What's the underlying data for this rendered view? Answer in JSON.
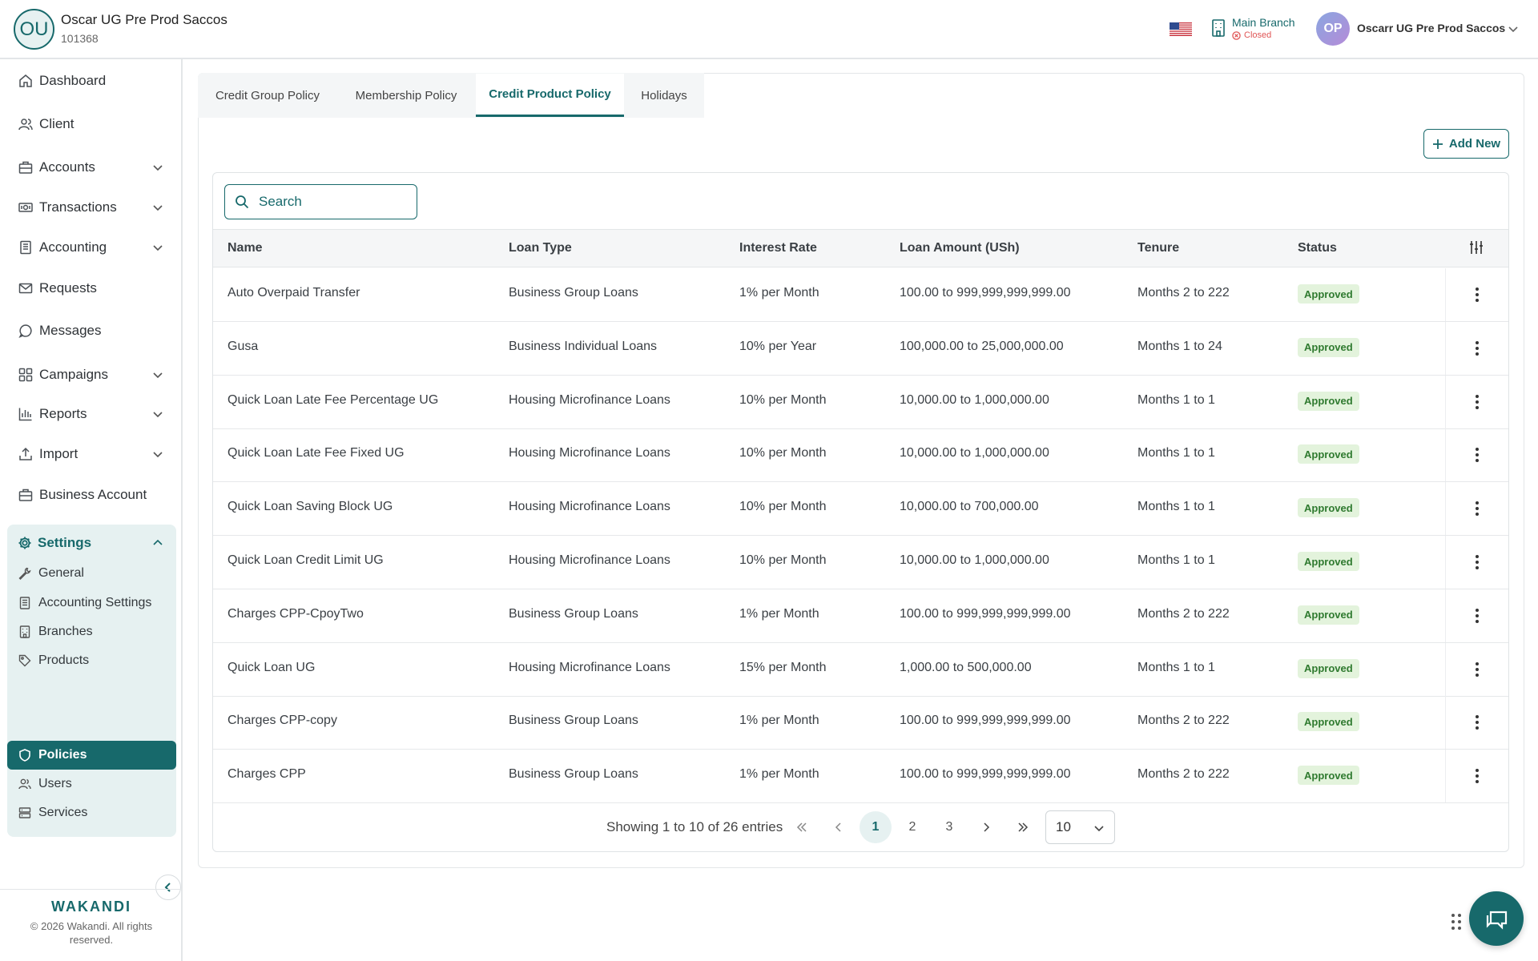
{
  "header": {
    "org_initials": "OU",
    "org_name": "Oscar UG Pre Prod Saccos",
    "org_id": "101368",
    "branch_name": "Main Branch",
    "branch_status": "Closed",
    "user_initials": "OP",
    "user_name": "Oscarr UG Pre Prod Saccos"
  },
  "sidebar": {
    "items": [
      {
        "label": "Dashboard",
        "icon": "home-icon"
      },
      {
        "label": "Client",
        "icon": "users-icon"
      },
      {
        "label": "Accounts",
        "icon": "briefcase-icon"
      },
      {
        "label": "Transactions",
        "icon": "cash-icon"
      },
      {
        "label": "Accounting",
        "icon": "ledger-icon"
      },
      {
        "label": "Requests",
        "icon": "mail-icon"
      },
      {
        "label": "Messages",
        "icon": "chat-icon"
      },
      {
        "label": "Campaigns",
        "icon": "grid-icon"
      },
      {
        "label": "Reports",
        "icon": "bar-chart-icon"
      },
      {
        "label": "Import",
        "icon": "upload-icon"
      },
      {
        "label": "Business Account",
        "icon": "briefcase-icon"
      }
    ],
    "settings": {
      "label": "Settings",
      "items": [
        {
          "label": "General"
        },
        {
          "label": "Accounting Settings"
        },
        {
          "label": "Branches"
        },
        {
          "label": "Products"
        },
        {
          "label": "Policies"
        },
        {
          "label": "Users"
        },
        {
          "label": "Services"
        }
      ]
    },
    "footer": {
      "logo": "WAKANDI",
      "copyright": "© 2026 Wakandi. All rights reserved."
    }
  },
  "tabs": [
    "Credit Group Policy",
    "Membership Policy",
    "Credit Product Policy",
    "Holidays"
  ],
  "active_tab": "Credit Product Policy",
  "add_button": "Add New",
  "search": {
    "placeholder": "Search"
  },
  "table": {
    "columns": [
      "Name",
      "Loan Type",
      "Interest Rate",
      "Loan Amount (USh)",
      "Tenure",
      "Status"
    ],
    "rows": [
      {
        "name": "Auto Overpaid Transfer",
        "loan_type": "Business Group Loans",
        "interest": "1% per Month",
        "amount": "100.00 to 999,999,999,999.00",
        "tenure": "Months 2 to 222",
        "status": "Approved"
      },
      {
        "name": "Gusa",
        "loan_type": "Business Individual Loans",
        "interest": "10% per Year",
        "amount": "100,000.00 to 25,000,000.00",
        "tenure": "Months 1 to 24",
        "status": "Approved"
      },
      {
        "name": "Quick Loan Late Fee Percentage UG",
        "loan_type": "Housing Microfinance Loans",
        "interest": "10% per Month",
        "amount": "10,000.00 to 1,000,000.00",
        "tenure": "Months 1 to 1",
        "status": "Approved"
      },
      {
        "name": "Quick Loan Late Fee Fixed UG",
        "loan_type": "Housing Microfinance Loans",
        "interest": "10% per Month",
        "amount": "10,000.00 to 1,000,000.00",
        "tenure": "Months 1 to 1",
        "status": "Approved"
      },
      {
        "name": "Quick Loan Saving Block UG",
        "loan_type": "Housing Microfinance Loans",
        "interest": "10% per Month",
        "amount": "10,000.00 to 700,000.00",
        "tenure": "Months 1 to 1",
        "status": "Approved"
      },
      {
        "name": "Quick Loan Credit Limit UG",
        "loan_type": "Housing Microfinance Loans",
        "interest": "10% per Month",
        "amount": "10,000.00 to 1,000,000.00",
        "tenure": "Months 1 to 1",
        "status": "Approved"
      },
      {
        "name": "Charges CPP-CpoyTwo",
        "loan_type": "Business Group Loans",
        "interest": "1% per Month",
        "amount": "100.00 to 999,999,999,999.00",
        "tenure": "Months 2 to 222",
        "status": "Approved"
      },
      {
        "name": "Quick Loan UG",
        "loan_type": "Housing Microfinance Loans",
        "interest": "15% per Month",
        "amount": "1,000.00 to 500,000.00",
        "tenure": "Months 1 to 1",
        "status": "Approved"
      },
      {
        "name": "Charges CPP-copy",
        "loan_type": "Business Group Loans",
        "interest": "1% per Month",
        "amount": "100.00 to 999,999,999,999.00",
        "tenure": "Months 2 to 222",
        "status": "Approved"
      },
      {
        "name": "Charges CPP",
        "loan_type": "Business Group Loans",
        "interest": "1% per Month",
        "amount": "100.00 to 999,999,999,999.00",
        "tenure": "Months 2 to 222",
        "status": "Approved"
      }
    ]
  },
  "pagination": {
    "info": "Showing 1 to 10 of 26 entries",
    "pages": [
      "1",
      "2",
      "3"
    ],
    "current_page": "1",
    "page_size": "10"
  },
  "colors": {
    "accent": "#17696b",
    "approved_bg": "#e3f3dc",
    "approved_text": "#2f7a2f",
    "closed": "#e05555"
  }
}
